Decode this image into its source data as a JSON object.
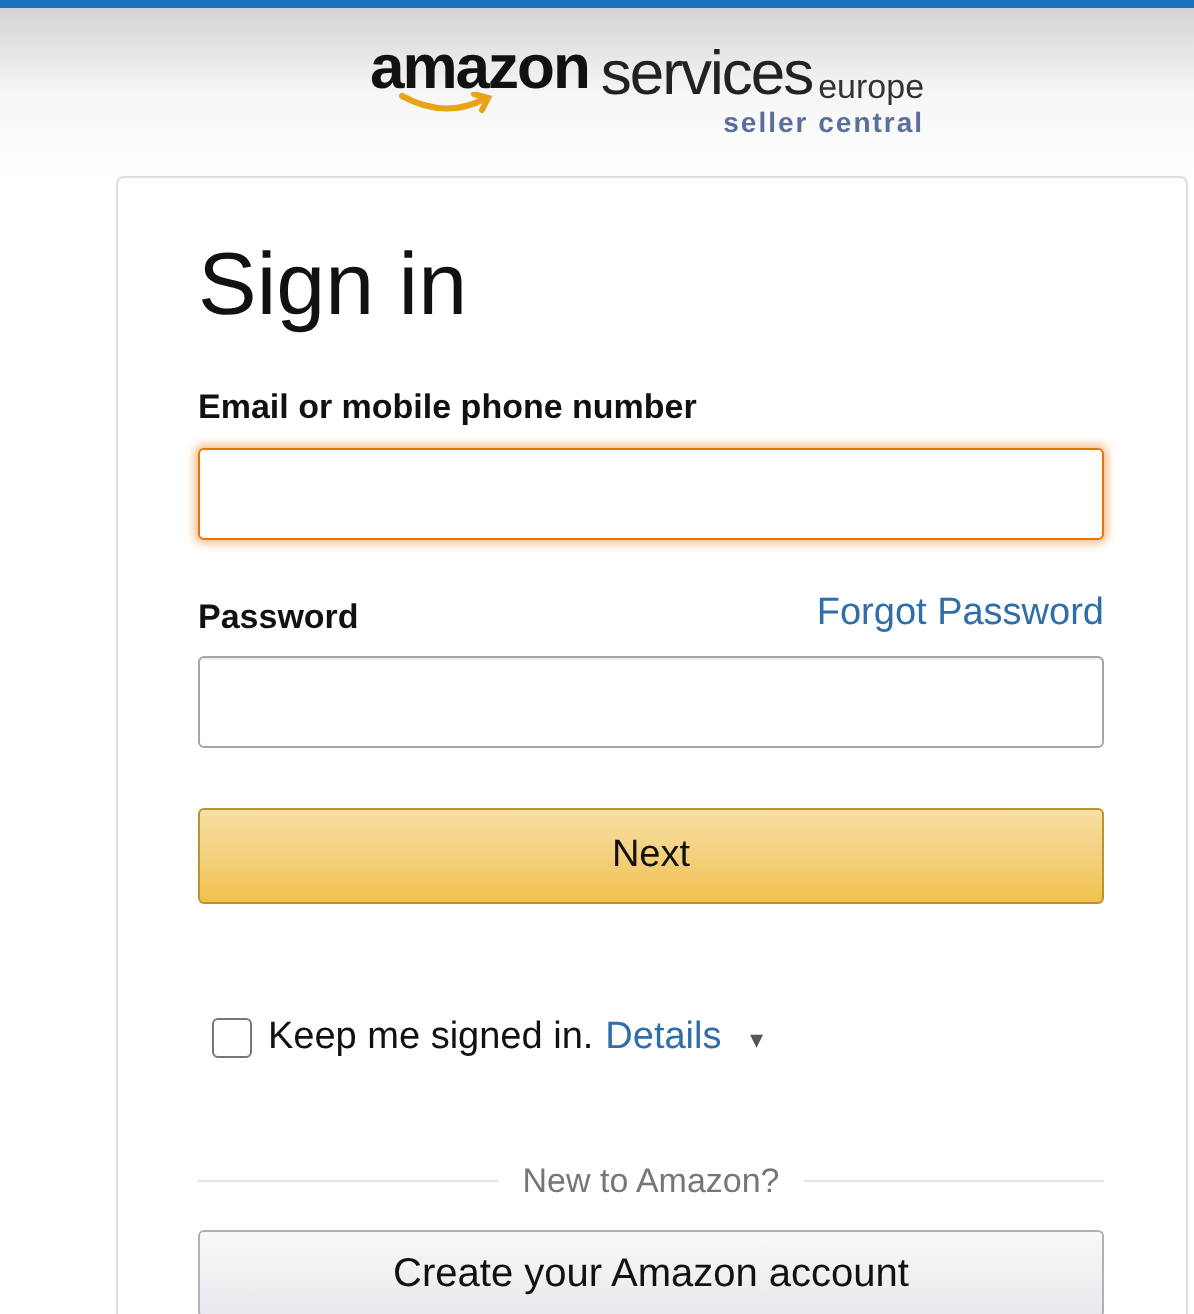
{
  "logo": {
    "brand": "amazon",
    "product": "services",
    "region": "europe",
    "subtitle": "seller central"
  },
  "title": "Sign in",
  "fields": [
    {
      "label": "Email or mobile phone number",
      "focused": true
    },
    {
      "label": "Password",
      "focused": false,
      "link": "Forgot Password"
    }
  ],
  "next_button": "Next",
  "keep_signed_in": {
    "label": "Keep me signed in.",
    "checked": false,
    "link": "Details",
    "caret": "▾"
  },
  "divider_text": "New to Amazon?",
  "create_button": "Create your Amazon account"
}
